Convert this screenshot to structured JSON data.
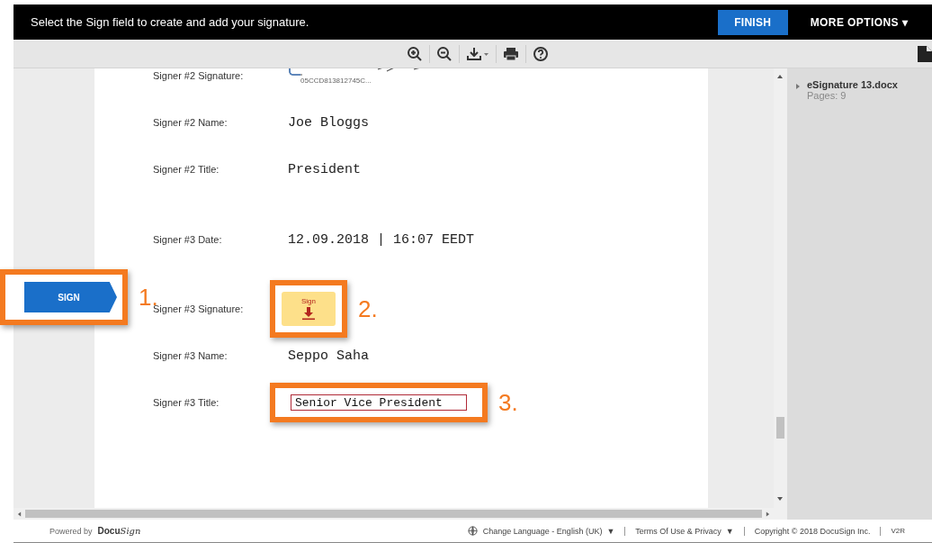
{
  "banner": {
    "message": "Select the Sign field to create and add your signature.",
    "finish_button": "FINISH",
    "more_options": "MORE OPTIONS",
    "more_caret": "▾"
  },
  "sign_tab": {
    "label": "SIGN",
    "annotation": "1."
  },
  "fields": [
    {
      "kind": "signature",
      "label": "Signer #2 Signature:",
      "caption": "05CCD813812745C..."
    },
    {
      "kind": "text",
      "label": "Signer #2 Name:",
      "value": "Joe Bloggs"
    },
    {
      "kind": "text",
      "label": "Signer #2 Title:",
      "value": "President"
    },
    {
      "kind": "text",
      "label": "Signer #3 Date:",
      "value": "12.09.2018 | 16:07 EEDT"
    },
    {
      "kind": "sign-button",
      "label": "Signer #3 Signature:",
      "button": "Sign",
      "annotation": "2."
    },
    {
      "kind": "text",
      "label": "Signer #3 Name:",
      "value": "Seppo Saha"
    },
    {
      "kind": "input",
      "label": "Signer #3 Title:",
      "value": "Senior Vice President",
      "annotation": "3."
    }
  ],
  "documents": [
    {
      "name": "eSignature 13.docx",
      "pages": "Pages: 9",
      "expanded": false
    }
  ],
  "footer": {
    "powered_by": "Powered by",
    "brand": "Docu",
    "brand_script": "Sign",
    "language": "Change Language - English (UK)",
    "terms": "Terms Of Use & Privacy",
    "dropdown_caret": "▼",
    "copyright": "Copyright © 2018 DocuSign Inc.",
    "version": "V2R"
  }
}
